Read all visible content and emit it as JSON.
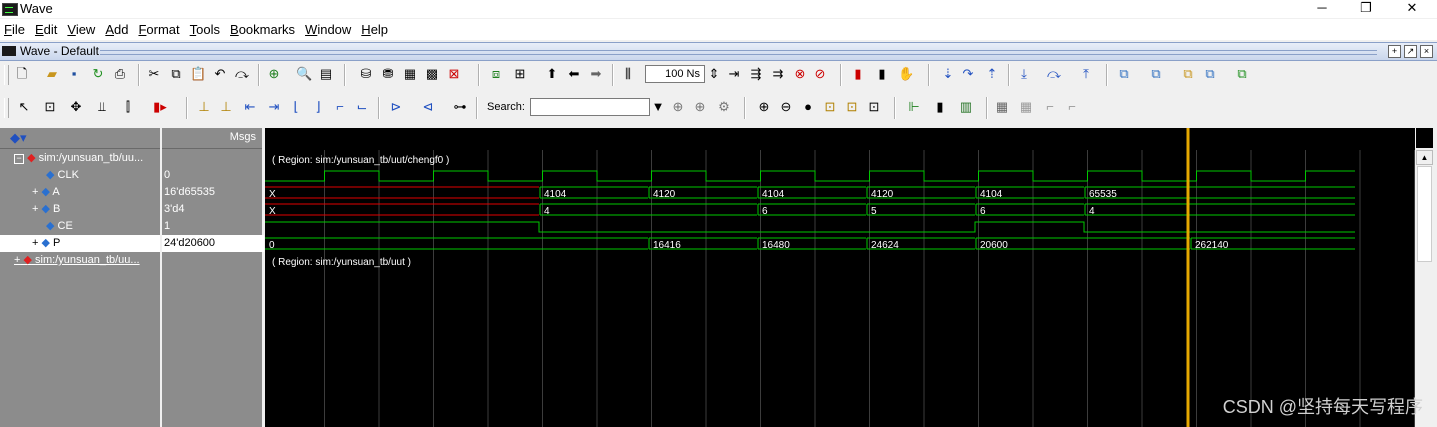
{
  "window": {
    "title": "Wave"
  },
  "menu": [
    "File",
    "Edit",
    "View",
    "Add",
    "Format",
    "Tools",
    "Bookmarks",
    "Window",
    "Help"
  ],
  "subwindow": {
    "title": "Wave - Default"
  },
  "toolbar": {
    "time_value": "100",
    "time_unit": "Ns",
    "search_label": "Search:",
    "search_value": ""
  },
  "panes": {
    "msgs_header": "Msgs"
  },
  "signals": [
    {
      "name": "sim:/yunsuan_tb/uu...",
      "value": "",
      "kind": "region"
    },
    {
      "name": "CLK",
      "value": "0",
      "kind": "bit"
    },
    {
      "name": "A",
      "value": "16'd65535",
      "kind": "bus"
    },
    {
      "name": "B",
      "value": "3'd4",
      "kind": "bus"
    },
    {
      "name": "CE",
      "value": "1",
      "kind": "bit"
    },
    {
      "name": "P",
      "value": "24'd20600",
      "kind": "bus"
    },
    {
      "name": "sim:/yunsuan_tb/uu...",
      "value": "",
      "kind": "region"
    }
  ],
  "wave": {
    "region1": "( Region: sim:/yunsuan_tb/uut/chengf0 )",
    "region2": "( Region: sim:/yunsuan_tb/uut )",
    "A_values": [
      "X",
      "4104",
      "4120",
      "4104",
      "4120",
      "4104",
      "65535"
    ],
    "B_values": [
      "X",
      "4",
      "6",
      "5",
      "6",
      "4"
    ],
    "P_values": [
      "0",
      "16416",
      "16480",
      "24624",
      "20600",
      "262140"
    ],
    "colors": {
      "bg": "#000000",
      "signal": "#00c800",
      "unknown": "#e00000",
      "cursor": "#e6a800",
      "grid": "#3c3c3c"
    }
  },
  "watermark": "CSDN @坚持每天写程序"
}
